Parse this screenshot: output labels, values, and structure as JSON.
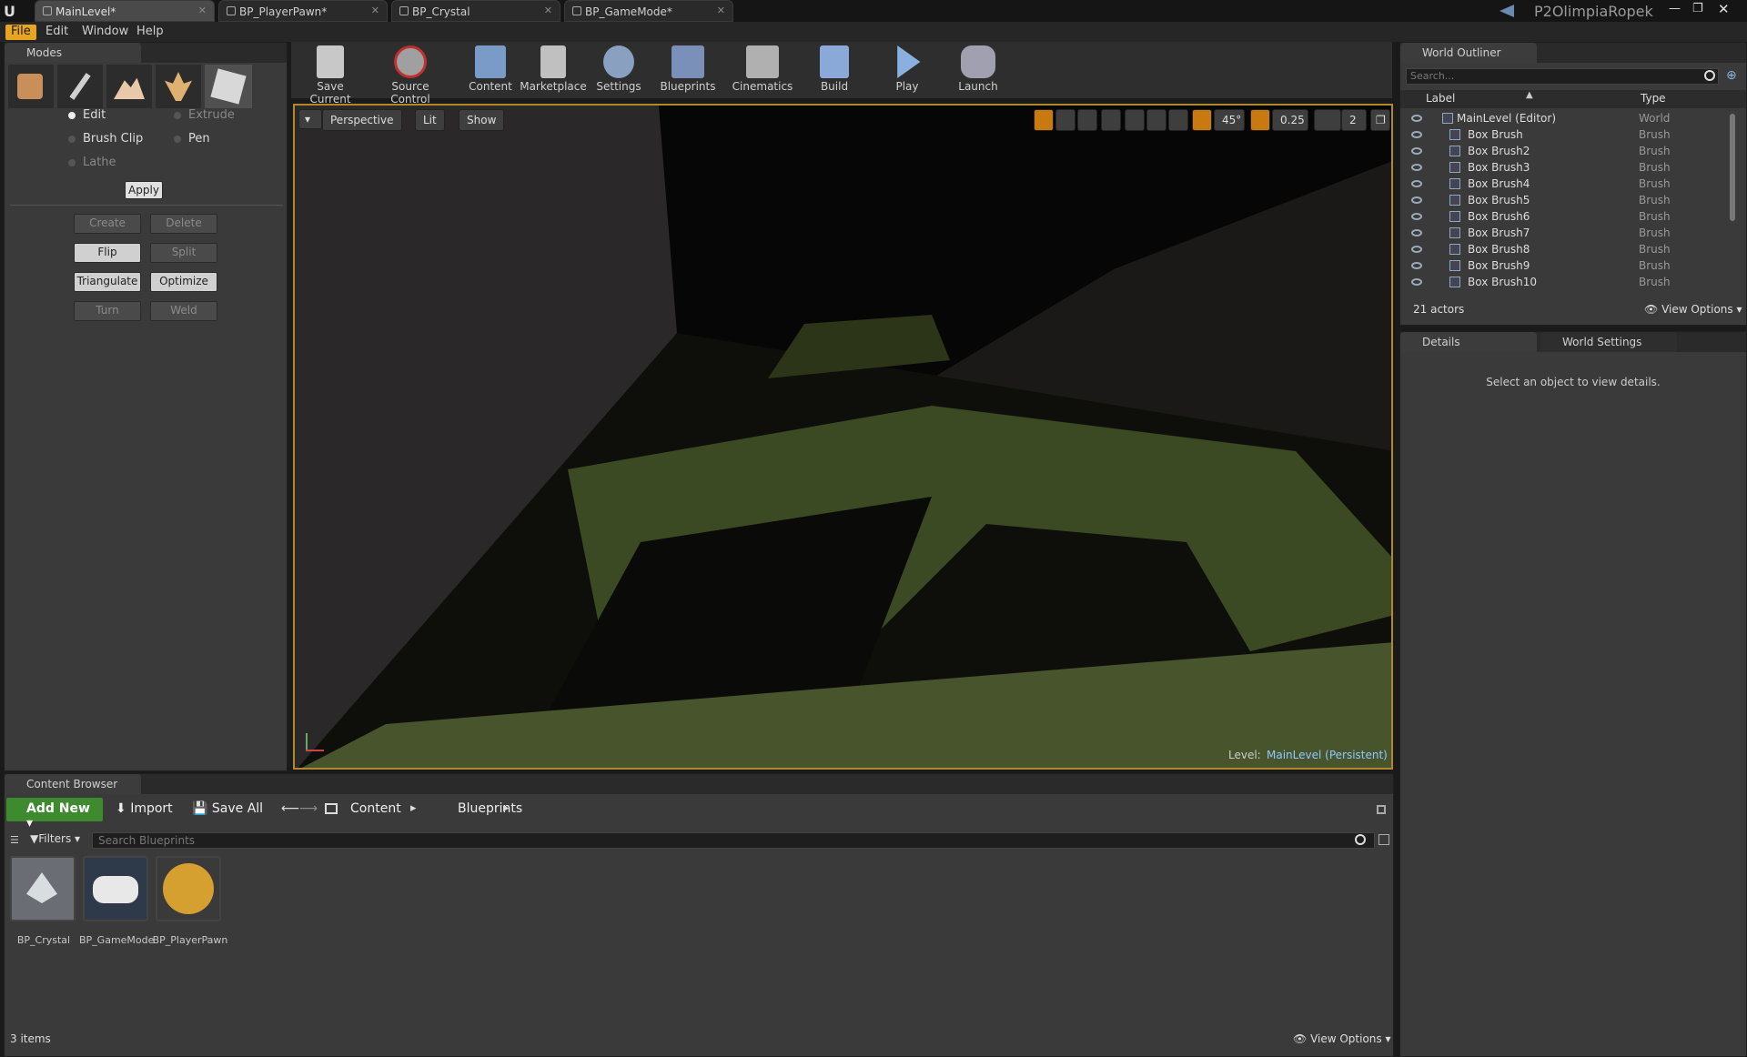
{
  "tabs": [
    {
      "label": "MainLevel*"
    },
    {
      "label": "BP_PlayerPawn*"
    },
    {
      "label": "BP_Crystal"
    },
    {
      "label": "BP_GameMode*"
    }
  ],
  "project_name": "P2OlimpiaRopek",
  "menu": {
    "items": [
      "File",
      "Edit",
      "Window",
      "Help"
    ]
  },
  "modes": {
    "title": "Modes",
    "options": [
      "Edit",
      "Extrude",
      "Brush Clip",
      "Pen",
      "Lathe"
    ],
    "apply": "Apply",
    "buttons": [
      "Create",
      "Delete",
      "Flip",
      "Split",
      "Triangulate",
      "Optimize",
      "Turn",
      "Weld"
    ]
  },
  "toolbar": {
    "items": [
      "Save Current",
      "Source Control",
      "Content",
      "Marketplace",
      "Settings",
      "Blueprints",
      "Cinematics",
      "Build",
      "Play",
      "Launch"
    ]
  },
  "viewport": {
    "perspective": "Perspective",
    "lit": "Lit",
    "show": "Show",
    "angle": "45°",
    "scale": "0.25",
    "camspeed": "2",
    "level_prefix": "Level:",
    "level_name": "MainLevel (Persistent)"
  },
  "outliner": {
    "title": "World Outliner",
    "search_placeholder": "Search...",
    "col_label": "Label",
    "col_type": "Type",
    "rows": [
      {
        "label": "MainLevel (Editor)",
        "type": "World"
      },
      {
        "label": "Box Brush",
        "type": "Brush"
      },
      {
        "label": "Box Brush2",
        "type": "Brush"
      },
      {
        "label": "Box Brush3",
        "type": "Brush"
      },
      {
        "label": "Box Brush4",
        "type": "Brush"
      },
      {
        "label": "Box Brush5",
        "type": "Brush"
      },
      {
        "label": "Box Brush6",
        "type": "Brush"
      },
      {
        "label": "Box Brush7",
        "type": "Brush"
      },
      {
        "label": "Box Brush8",
        "type": "Brush"
      },
      {
        "label": "Box Brush9",
        "type": "Brush"
      },
      {
        "label": "Box Brush10",
        "type": "Brush"
      }
    ],
    "count": "21 actors",
    "view_options": "View Options"
  },
  "details": {
    "tab1": "Details",
    "tab2": "World Settings",
    "empty_msg": "Select an object to view details."
  },
  "content_browser": {
    "title": "Content Browser",
    "add_new": "Add New",
    "import": "Import",
    "save_all": "Save All",
    "path": [
      "Content",
      "Blueprints"
    ],
    "filters": "Filters",
    "search_placeholder": "Search Blueprints",
    "assets": [
      "BP_Crystal",
      "BP_GameMode",
      "BP_PlayerPawn"
    ],
    "count": "3 items",
    "view_options": "View Options"
  },
  "colors": {
    "accent": "#e8a520",
    "link": "#8ec8ff",
    "bg": "#3a3a3a"
  }
}
